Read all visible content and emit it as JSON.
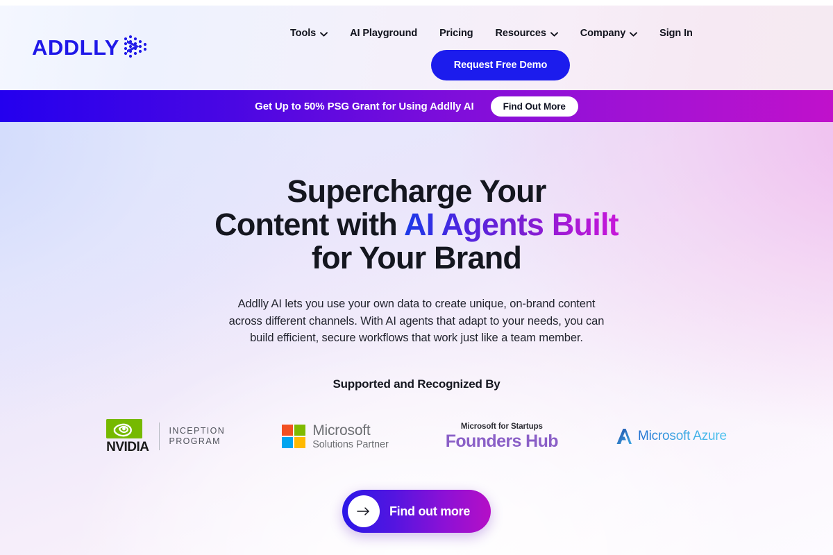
{
  "brand": {
    "logo_text": "ADDLLY",
    "logo_color": "#1f18e8"
  },
  "header": {
    "nav": [
      {
        "label": "Tools",
        "has_caret": true
      },
      {
        "label": "AI Playground",
        "has_caret": false
      },
      {
        "label": "Pricing",
        "has_caret": false
      },
      {
        "label": "Resources",
        "has_caret": true
      },
      {
        "label": "Company",
        "has_caret": true
      },
      {
        "label": "Sign In",
        "has_caret": false
      }
    ],
    "demo_button": "Request Free Demo"
  },
  "banner": {
    "text": "Get Up to 50% PSG Grant for Using Addlly AI",
    "button": "Find Out More",
    "gradient_from": "#2400ee",
    "gradient_to": "#c011cb"
  },
  "hero": {
    "headline_line1": "Supercharge Your",
    "headline_line2_plain": "Content with ",
    "headline_line2_gradient": "AI Agents Built",
    "headline_line3": "for Your Brand",
    "subtitle_line1": "Addlly AI lets you use your own data to create unique, on-brand content",
    "subtitle_line2": "across different channels. With AI agents that adapt to your needs, you can",
    "subtitle_line3": "build efficient, secure workflows that work just like a team member.",
    "gradient_from": "#1a3ae8",
    "gradient_to": "#c718d9"
  },
  "supported": {
    "title": "Supported and Recognized By",
    "logos": [
      {
        "name": "nvidia-inception-program",
        "wordmark": "NVIDIA",
        "line1": "INCEPTION",
        "line2": "PROGRAM",
        "color": "#76b900"
      },
      {
        "name": "microsoft-solutions-partner",
        "line1": "Microsoft",
        "line2": "Solutions Partner",
        "swatches": [
          "#f25022",
          "#7fba00",
          "#00a4ef",
          "#ffb900"
        ]
      },
      {
        "name": "microsoft-for-startups-founders-hub",
        "line1": "Microsoft for Startups",
        "line2": "Founders Hub",
        "color": "#8a5fc7"
      },
      {
        "name": "microsoft-azure",
        "line1": "Microsoft Azure",
        "color": "#3fa7e3"
      }
    ]
  },
  "cta": {
    "label": "Find out more",
    "icon": "arrow-right-icon",
    "gradient_from": "#2a17e8",
    "gradient_to": "#b50fc6"
  }
}
